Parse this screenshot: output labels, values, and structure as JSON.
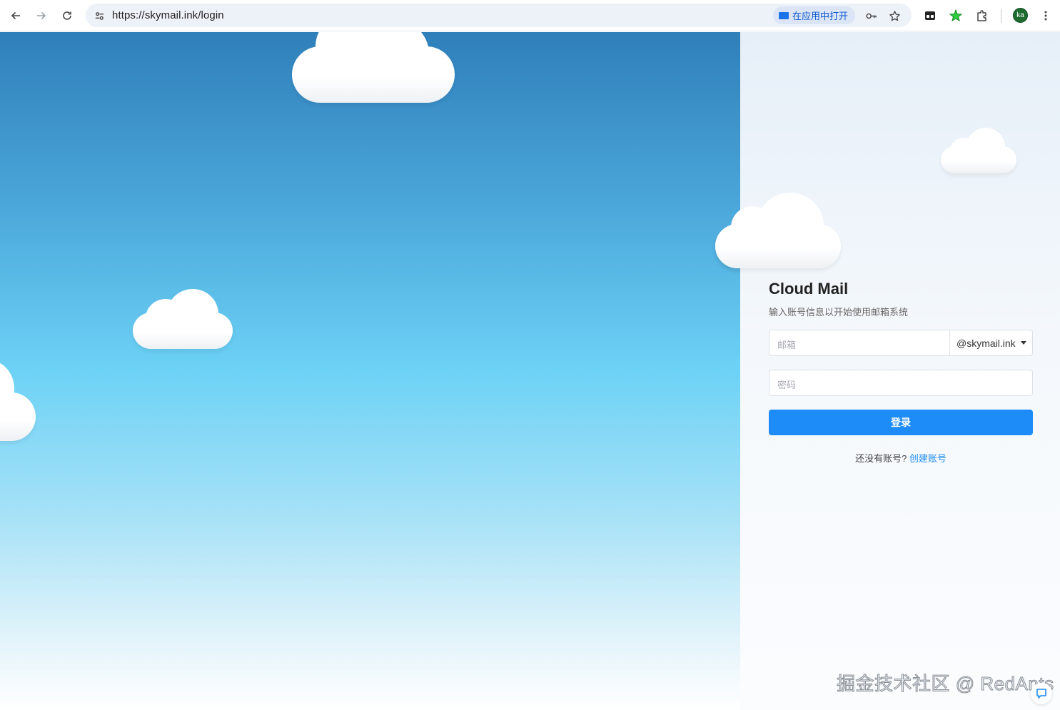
{
  "browser": {
    "url": "https://skymail.ink/login",
    "open_in_app": "在应用中打开",
    "avatar_initials": "ka"
  },
  "login": {
    "title": "Cloud Mail",
    "subtitle": "输入账号信息以开始使用邮箱系统",
    "email_placeholder": "邮箱",
    "domain": "@skymail.ink",
    "password_placeholder": "密码",
    "login_button": "登录",
    "no_account": "还没有账号?",
    "create_account": "创建账号"
  },
  "watermark": "掘金技术社区 @ RedAnts",
  "colors": {
    "primary": "#1d8cf8",
    "sky_top": "#2f7fba",
    "sky_mid": "#6dd2f6"
  }
}
